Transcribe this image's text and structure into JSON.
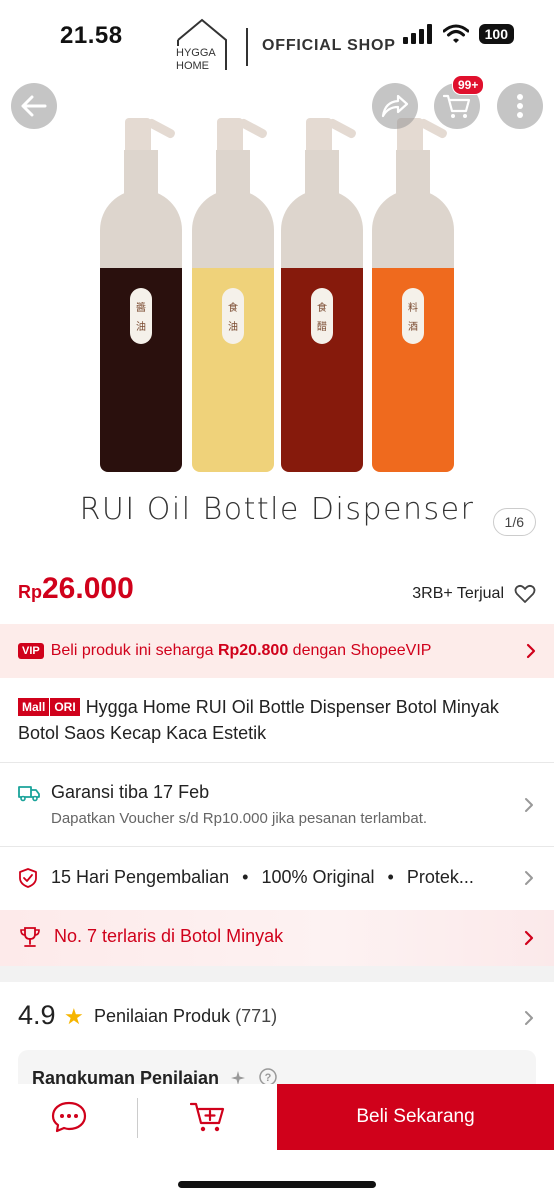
{
  "status": {
    "time": "21.58",
    "battery": "100"
  },
  "brand": {
    "line1": "HYGGA",
    "line2": "HOME",
    "shop_label": "OFFICIAL SHOP"
  },
  "hero": {
    "title": "RUI Oil Bottle Dispenser",
    "page_count": "1/6",
    "cart_badge": "99+",
    "bottles": [
      {
        "label_top": "醬",
        "label_bottom": "油",
        "color": "#2a100d"
      },
      {
        "label_top": "食",
        "label_bottom": "油",
        "color": "#efd27a"
      },
      {
        "label_top": "食",
        "label_bottom": "醋",
        "color": "#861a0c"
      },
      {
        "label_top": "料",
        "label_bottom": "酒",
        "color": "#ef6a1e"
      }
    ]
  },
  "price": {
    "currency": "Rp",
    "value": "26.000",
    "sold": "3RB+ Terjual"
  },
  "vip": {
    "badge": "VIP",
    "text_before": "Beli produk ini seharga ",
    "amount": "Rp20.800",
    "text_after": " dengan ShopeeVIP"
  },
  "product": {
    "mall_badge": "Mall",
    "ori_badge": "ORI",
    "title": "Hygga Home RUI Oil Bottle Dispenser Botol Minyak Botol Saos Kecap Kaca Estetik"
  },
  "shipping": {
    "title": "Garansi tiba 17 Feb",
    "subtitle": "Dapatkan Voucher s/d Rp10.000 jika pesanan terlambat."
  },
  "guarantee": {
    "item1": "15 Hari Pengembalian",
    "item2": "100% Original",
    "item3": "Protek..."
  },
  "bestseller": {
    "text": "No. 7 terlaris di Botol Minyak"
  },
  "rating": {
    "score": "4.9",
    "label": "Penilaian Produk",
    "count": "(771)"
  },
  "summary": {
    "title": "Rangkuman Penilaian"
  },
  "bottom": {
    "buy_label": "Beli Sekarang"
  },
  "colors": {
    "accent": "#d0011b",
    "star": "#f6b500"
  }
}
